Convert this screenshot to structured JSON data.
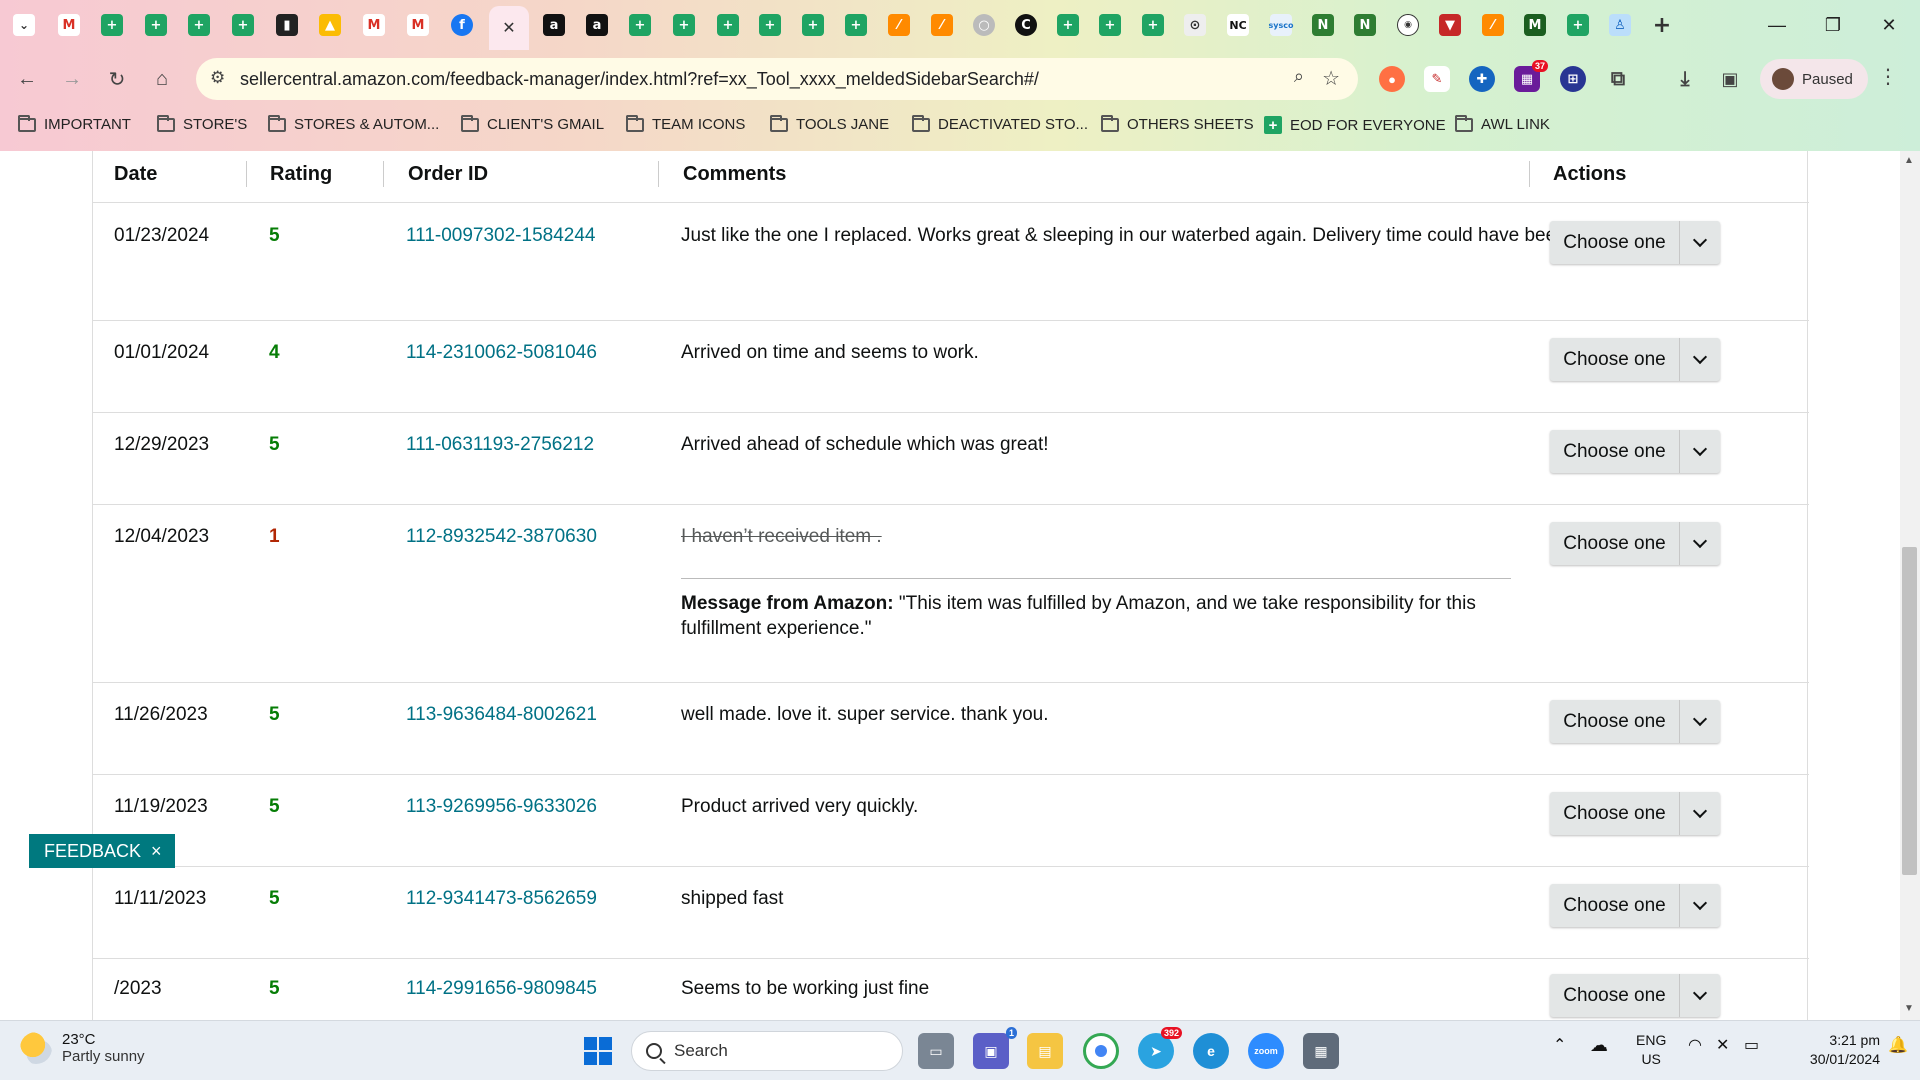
{
  "browser": {
    "url": "sellercentral.amazon.com/feedback-manager/index.html?ref=xx_Tool_xxxx_meldedSidebarSearch#/",
    "profile_label": "Paused",
    "extension_badge": "37",
    "bookmarks": [
      {
        "label": "IMPORTANT",
        "icon": "folder-icon"
      },
      {
        "label": "STORE'S",
        "icon": "folder-icon"
      },
      {
        "label": "STORES & AUTOM...",
        "icon": "folder-icon"
      },
      {
        "label": "CLIENT'S GMAIL",
        "icon": "folder-icon"
      },
      {
        "label": "TEAM ICONS",
        "icon": "folder-icon"
      },
      {
        "label": "TOOLS JANE",
        "icon": "folder-icon"
      },
      {
        "label": "DEACTIVATED STO...",
        "icon": "folder-icon"
      },
      {
        "label": "OTHERS SHEETS",
        "icon": "folder-icon"
      },
      {
        "label": "EOD FOR EVERYONE",
        "icon": "sheets-icon"
      },
      {
        "label": "AWL LINK",
        "icon": "folder-icon"
      }
    ]
  },
  "table": {
    "headers": {
      "date": "Date",
      "rating": "Rating",
      "order_id": "Order ID",
      "comments": "Comments",
      "actions": "Actions"
    },
    "rows": [
      {
        "date": "01/23/2024",
        "rating": "5",
        "order_id": "111-0097302-1584244",
        "comment": "Just like the one I replaced. Works great & sleeping in our waterbed again. Delivery time could have been better.",
        "action": "Choose one"
      },
      {
        "date": "01/01/2024",
        "rating": "4",
        "order_id": "114-2310062-5081046",
        "comment": "Arrived on time and seems to work.",
        "action": "Choose one"
      },
      {
        "date": "12/29/2023",
        "rating": "5",
        "order_id": "111-0631193-2756212",
        "comment": "Arrived ahead of schedule which was great!",
        "action": "Choose one"
      },
      {
        "date": "12/04/2023",
        "rating": "1",
        "order_id": "112-8932542-3870630",
        "comment": "I haven’t received item .",
        "message_label": "Message from Amazon:",
        "message": "\"This item was fulfilled by Amazon, and we take responsibility for this fulfillment experience.\"",
        "action": "Choose one"
      },
      {
        "date": "11/26/2023",
        "rating": "5",
        "order_id": "113-9636484-8002621",
        "comment": "well made. love it. super service. thank you.",
        "action": "Choose one"
      },
      {
        "date": "11/19/2023",
        "rating": "5",
        "order_id": "113-9269956-9633026",
        "comment": "Product arrived very quickly.",
        "action": "Choose one"
      },
      {
        "date": "11/11/2023",
        "rating": "5",
        "order_id": "112-9341473-8562659",
        "comment": "shipped fast",
        "action": "Choose one"
      },
      {
        "date": "/2023",
        "rating": "5",
        "order_id": "114-2991656-9809845",
        "comment": "Seems to be working just fine",
        "action": "Choose one"
      }
    ]
  },
  "feedback_tab": {
    "label": "FEEDBACK",
    "close": "×"
  },
  "taskbar": {
    "weather_temp": "23°C",
    "weather_desc": "Partly sunny",
    "search_label": "Search",
    "teams_badge": "1",
    "telegram_badge": "392",
    "lang_top": "ENG",
    "lang_bottom": "US",
    "time": "3:21 pm",
    "date": "30/01/2024"
  },
  "colors": {
    "rating_good": "#067d06",
    "rating_bad": "#b12704",
    "order_link": "#007185",
    "feedback_tab": "#00797f"
  }
}
